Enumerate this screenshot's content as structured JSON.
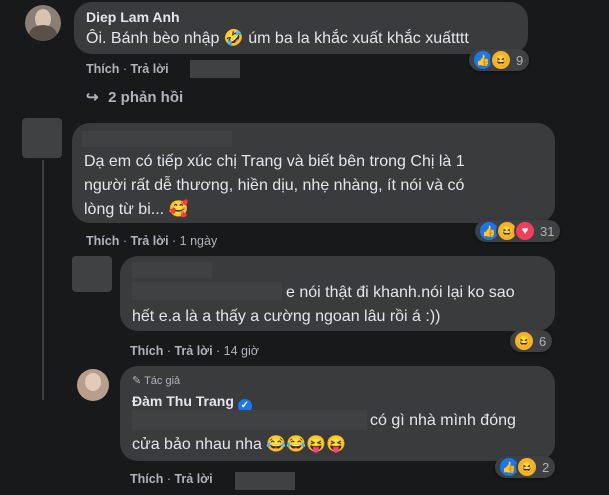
{
  "comments": [
    {
      "author": "Diep Lam Anh",
      "text": "Ôi. Bánh bèo nhập 🤣 úm ba la khắc xuất khắc xuấtttt",
      "like_label": "Thích",
      "reply_label": "Trả lời",
      "reactions": [
        "like",
        "haha"
      ],
      "reaction_count": "9"
    },
    {
      "replies_label": "2 phản hồi"
    },
    {
      "text_line1": "Dạ em có tiếp xúc chị Trang và biết bên trong Chị là 1",
      "text_line2": "người rất dễ thương, hiền dịu, nhẹ nhàng, ít nói và có",
      "text_line3": "lòng từ bi... 🥰",
      "like_label": "Thích",
      "reply_label": "Trả lời",
      "time": "1 ngày",
      "reactions": [
        "like",
        "haha",
        "love"
      ],
      "reaction_count": "31"
    },
    {
      "text_line1": "e nói thật đi khanh.nói lại ko sao",
      "text_line2": "hết e.a là a thấy a cường ngoan lâu rồi á :))",
      "like_label": "Thích",
      "reply_label": "Trả lời",
      "time": "14 giờ",
      "reactions": [
        "haha"
      ],
      "reaction_count": "6"
    },
    {
      "badge": "Tác giả",
      "author": "Đàm Thu Trang",
      "text_line1": "có gì nhà mình đóng",
      "text_line2": "cửa bảo nhau nha 😂😂😝😝",
      "like_label": "Thích",
      "reply_label": "Trả lời",
      "reactions": [
        "like",
        "haha"
      ],
      "reaction_count": "2"
    }
  ]
}
